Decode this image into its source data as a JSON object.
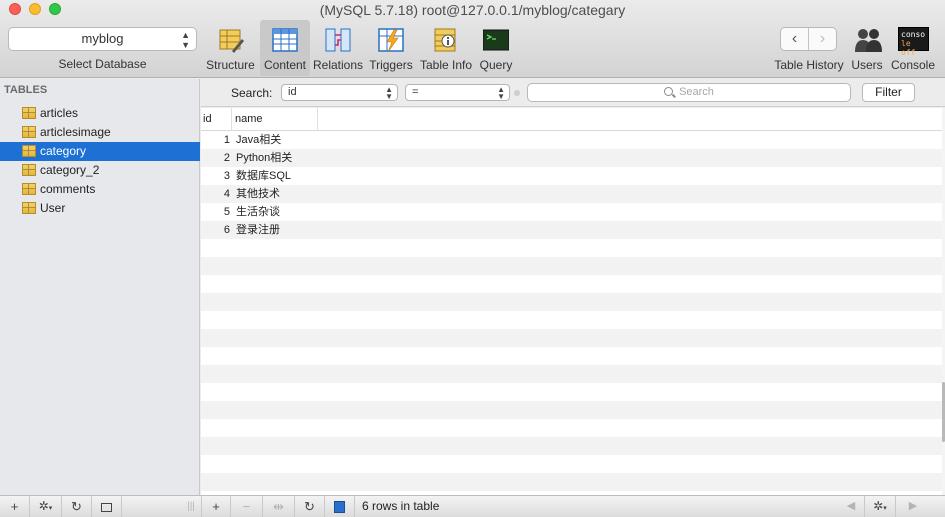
{
  "window": {
    "title": "(MySQL 5.7.18) root@127.0.0.1/myblog/categary"
  },
  "database": {
    "selected": "myblog",
    "caption": "Select Database"
  },
  "toolbar": {
    "structure": "Structure",
    "content": "Content",
    "relations": "Relations",
    "triggers": "Triggers",
    "table_info": "Table Info",
    "query": "Query",
    "history": "Table History",
    "users": "Users",
    "console": "Console",
    "console_icon_line1": "conso",
    "console_icon_line2": "le off",
    "back": "‹",
    "forward": "›"
  },
  "sidebar": {
    "header": "TABLES",
    "tables": [
      "articles",
      "articlesimage",
      "category",
      "category_2",
      "comments",
      "User"
    ],
    "selected_index": 2
  },
  "filter": {
    "label": "Search:",
    "field": "id",
    "operator": "=",
    "search_placeholder": "Search",
    "button": "Filter"
  },
  "grid": {
    "columns": [
      "id",
      "name"
    ],
    "rows": [
      [
        "1",
        "Java相关"
      ],
      [
        "2",
        "Python相关"
      ],
      [
        "3",
        "数据库SQL"
      ],
      [
        "4",
        "其他技术"
      ],
      [
        "5",
        "生活杂谈"
      ],
      [
        "6",
        "登录注册"
      ]
    ]
  },
  "status": {
    "row_count": "6 rows in table"
  },
  "bottombar": {
    "add": "+",
    "remove": "−",
    "settings": "✲",
    "refresh": "↻",
    "divider": "|||",
    "prev": "◀",
    "next": "▶"
  },
  "colors": {
    "selection": "#1d70d4",
    "close": "#fc5f57",
    "minimize": "#fdbc2e",
    "maximize": "#33c748"
  }
}
